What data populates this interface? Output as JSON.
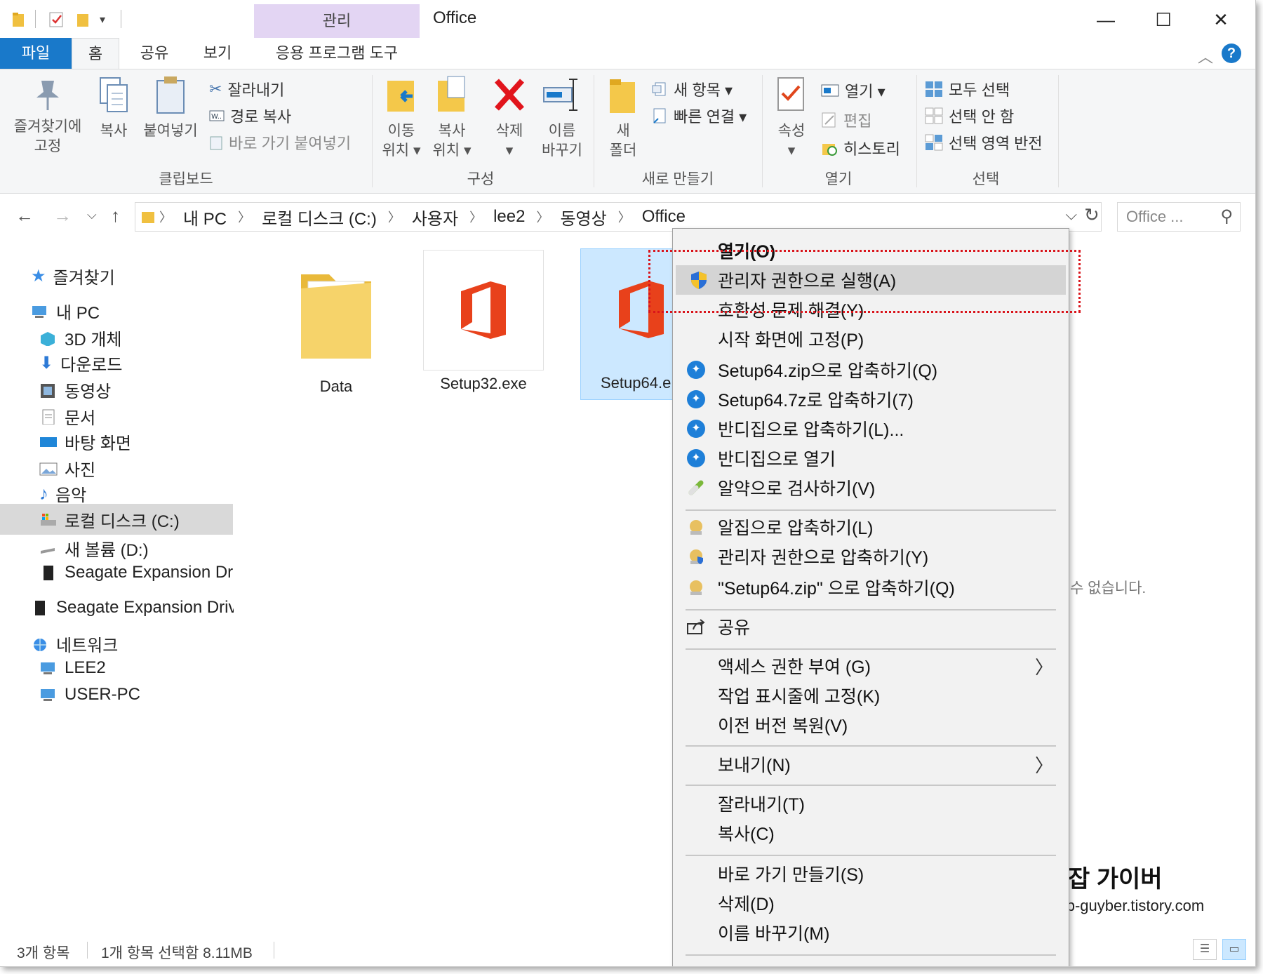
{
  "window": {
    "manage_tab": "관리",
    "title": "Office",
    "minimize": "—",
    "maximize": "☐",
    "close": "✕"
  },
  "tabs": {
    "file": "파일",
    "home": "홈",
    "share": "공유",
    "view": "보기",
    "app_tools": "응용 프로그램 도구"
  },
  "ribbon": {
    "clipboard": {
      "pin_quick": "즐겨찾기에\n고정",
      "pin_line1": "즐겨찾기에",
      "pin_line2": "고정",
      "copy": "복사",
      "paste": "붙여넣기",
      "cut": "잘라내기",
      "copy_path": "경로 복사",
      "paste_shortcut": "바로 가기 붙여넣기",
      "label": "클립보드"
    },
    "organize": {
      "move_line1": "이동",
      "move_line2": "위치 ▾",
      "copy_line1": "복사",
      "copy_line2": "위치 ▾",
      "delete_line1": "삭제",
      "delete_line2": "▾",
      "rename_line1": "이름",
      "rename_line2": "바꾸기",
      "label": "구성"
    },
    "new": {
      "new_folder_line1": "새",
      "new_folder_line2": "폴더",
      "new_item": "새 항목 ▾",
      "easy_access": "빠른 연결 ▾",
      "label": "새로 만들기"
    },
    "open": {
      "properties_line1": "속성",
      "properties_line2": "▾",
      "open": "열기 ▾",
      "edit": "편집",
      "history": "히스토리",
      "label": "열기"
    },
    "select": {
      "select_all": "모두 선택",
      "select_none": "선택 안 함",
      "invert": "선택 영역 반전",
      "label": "선택"
    }
  },
  "address": {
    "crumbs": [
      "내 PC",
      "로컬 디스크 (C:)",
      "사용자",
      "lee2",
      "동영상",
      "Office"
    ],
    "search_placeholder": "Office ..."
  },
  "nav": {
    "quick_access": "즐겨찾기",
    "this_pc": "내 PC",
    "objects3d": "3D 개체",
    "downloads": "다운로드",
    "videos": "동영상",
    "documents": "문서",
    "desktop": "바탕 화면",
    "pictures": "사진",
    "music": "음악",
    "local_disk": "로컬 디스크 (C:)",
    "new_volume": "새 볼륨 (D:)",
    "seagate1": "Seagate Expansion Dr",
    "seagate2": "Seagate Expansion Driv",
    "network": "네트워크",
    "lee2": "LEE2",
    "userpc": "USER-PC"
  },
  "files": [
    {
      "name": "Data",
      "type": "folder"
    },
    {
      "name": "Setup32.exe",
      "type": "office"
    },
    {
      "name": "Setup64.e",
      "type": "office"
    }
  ],
  "context_menu": {
    "open": "열기(O)",
    "run_as_admin": "관리자 권한으로 실행(A)",
    "troubleshoot": "호환성 문제 해결(Y)",
    "pin_start": "시작 화면에 고정(P)",
    "zip": "Setup64.zip으로 압축하기(Q)",
    "7z": "Setup64.7z로 압축하기(7)",
    "bandizip_compress": "반디집으로 압축하기(L)...",
    "bandizip_open": "반디집으로 열기",
    "alyac_scan": "알약으로 검사하기(V)",
    "alzip_compress": "알집으로 압축하기(L)",
    "alzip_admin": "관리자 권한으로 압축하기(Y)",
    "alzip_zip": "\"Setup64.zip\" 으로 압축하기(Q)",
    "share": "공유",
    "give_access": "액세스 권한 부여 (G)",
    "pin_taskbar": "작업 표시줄에 고정(K)",
    "restore_versions": "이전 버전 복원(V)",
    "send_to": "보내기(N)",
    "cut": "잘라내기(T)",
    "copy": "복사(C)",
    "create_shortcut": "바로 가기 만들기(S)",
    "delete": "삭제(D)",
    "rename": "이름 바꾸기(M)"
  },
  "content": {
    "empty_note": "수 없습니다.",
    "brand": "잡 가이버",
    "brand_url": "https://JAb-guyber.tistory.com"
  },
  "status": {
    "count": "3개 항목",
    "selected": "1개 항목 선택함 8.11MB"
  },
  "colors": {
    "file_tab": "#1979ca",
    "manage_tab": "#e3d5f3",
    "selection": "#cce8ff",
    "office_red": "#e8411b",
    "highlight_box": "#d9141b"
  }
}
